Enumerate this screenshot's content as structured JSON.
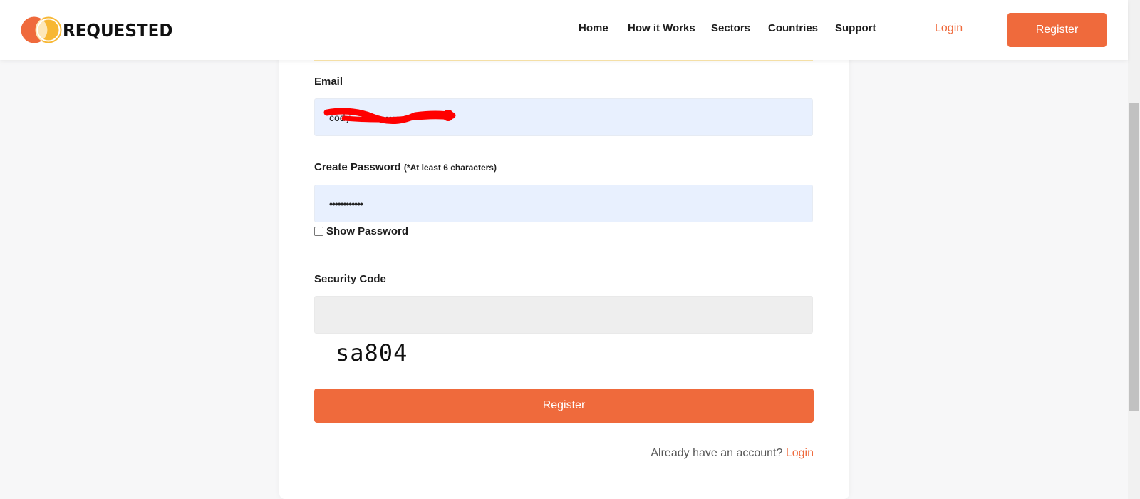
{
  "brand": {
    "name": "REQUESTED",
    "colors": {
      "accent": "#ef6a3c",
      "logo_yellow": "#f7b733",
      "input_bg": "#e8f0fe"
    }
  },
  "nav": {
    "items": [
      "Home",
      "How it Works",
      "Sectors",
      "Countries",
      "Support"
    ],
    "login_label": "Login",
    "register_label": "Register"
  },
  "form": {
    "email_label": "Email",
    "email_value": "cody•••••••••••••••c",
    "password_label": "Create Password",
    "password_hint": "(*At least 6 characters)",
    "password_value": "••••••••••••",
    "show_password_label": "Show Password",
    "security_label": "Security Code",
    "captcha_text": "sa804",
    "submit_label": "Register",
    "already_text": "Already have an account?",
    "already_link": "Login"
  }
}
